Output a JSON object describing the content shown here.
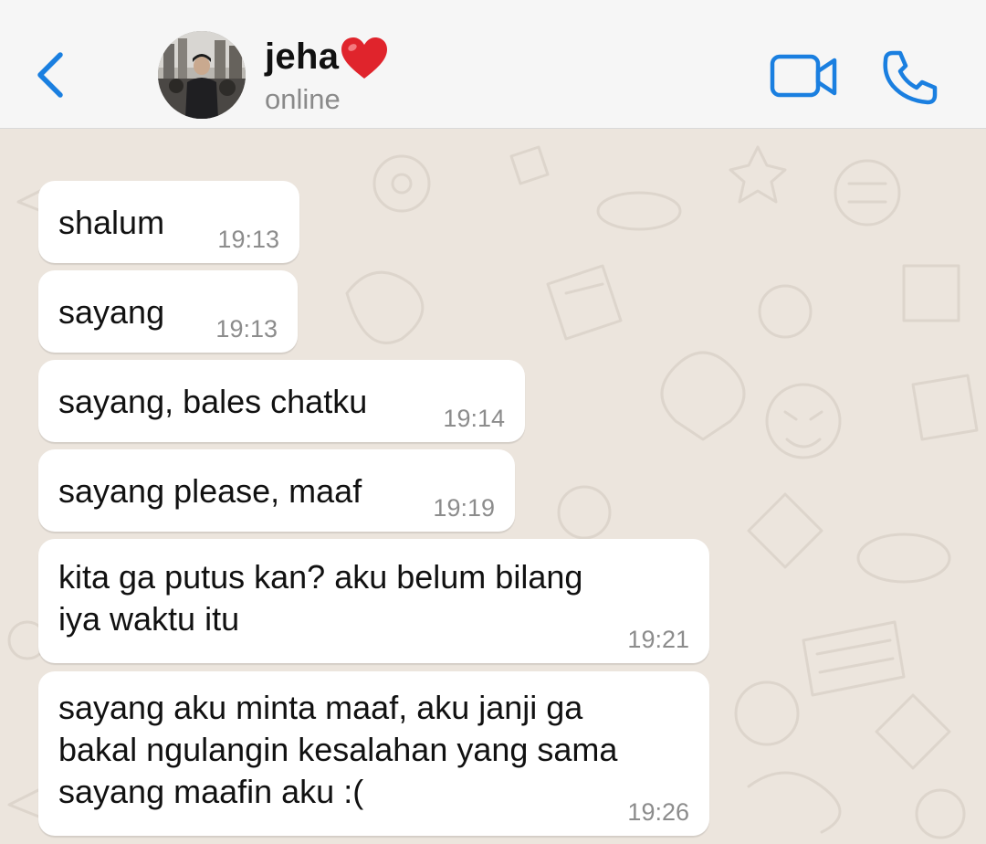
{
  "header": {
    "contact_name": "jeha",
    "status": "online"
  },
  "icons": {
    "back": "chevron-left-icon",
    "heart": "red-heart-emoji",
    "video": "video-camera-icon",
    "phone": "phone-icon"
  },
  "colors": {
    "accent": "#1a7fe0",
    "wallpaper": "#ece5dd",
    "bubble": "#ffffff",
    "heart": "#e0242c"
  },
  "messages": [
    {
      "text": "shalum",
      "time": "19:13"
    },
    {
      "text": "sayang",
      "time": "19:13"
    },
    {
      "text": "sayang, bales chatku",
      "time": "19:14"
    },
    {
      "text": "sayang please, maaf",
      "time": "19:19"
    },
    {
      "text": "kita ga putus kan? aku belum bilang\niya waktu itu",
      "time": "19:21"
    },
    {
      "text": "sayang aku minta maaf, aku janji ga\nbakal ngulangin kesalahan yang sama\nsayang maafin aku :(",
      "time": "19:26"
    }
  ]
}
